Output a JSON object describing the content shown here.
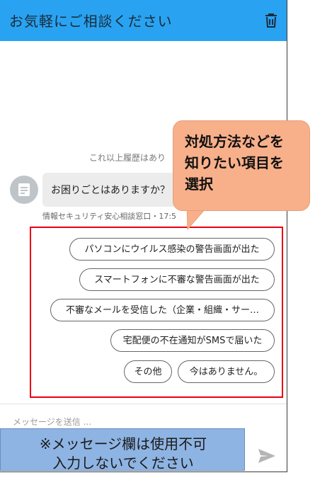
{
  "header": {
    "title": "お気軽にご相談ください",
    "trash_icon": "trash-icon"
  },
  "chat": {
    "history_note": "これ以上履歴はあり",
    "bot_message": "お困りごとはありますか？",
    "sender_line": "情報セキュリティ安心相談窓口・17:5"
  },
  "callout": {
    "lines": [
      "対処方法などを",
      "知りたい項目を",
      "選択"
    ]
  },
  "quick_replies": [
    "パソコンにウイルス感染の警告画面が出た",
    "スマートフォンに不審な警告画面が出た",
    "不審なメールを受信した（企業・組織・サー…",
    "宅配便の不在通知がSMSで届いた",
    "その他",
    "今はありません。"
  ],
  "input": {
    "placeholder": "メッセージを送信 ..."
  },
  "warning": {
    "line1": "※メッセージ欄は使用不可",
    "line2": "入力しないでください"
  },
  "colors": {
    "header": "#29a3f1",
    "highlight_border": "#e60012",
    "callout": "#f8b08a",
    "warning": "#8eb4e3"
  }
}
